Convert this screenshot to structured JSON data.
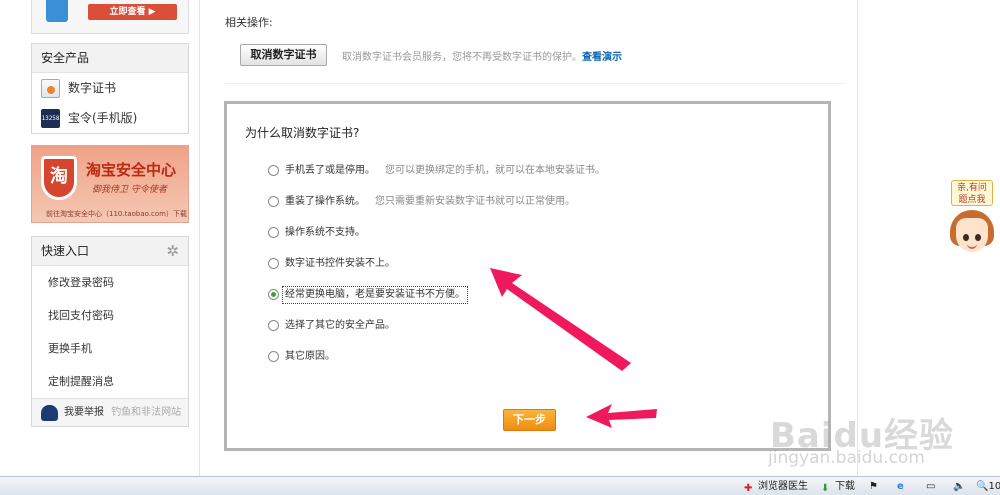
{
  "top_banner": {
    "button_label": "立即查看 ▶"
  },
  "security_products": {
    "title": "安全产品",
    "items": [
      {
        "label": "数字证书",
        "icon": "certificate-icon"
      },
      {
        "label": "宝令(手机版)",
        "icon": "token-icon",
        "icon_text": "13258"
      }
    ]
  },
  "ad": {
    "shield_char": "淘",
    "title": "淘宝安全中心",
    "slogan": "御我侍卫 守令使者",
    "footer": "前往淘宝安全中心（110.taobao.com）下载"
  },
  "quick_entry": {
    "title": "快速入口",
    "items": [
      "修改登录密码",
      "找回支付密码",
      "更换手机",
      "定制提醒消息"
    ],
    "report_label": "我要举报",
    "report_sub": "钓鱼和非法网站"
  },
  "related": {
    "label": "相关操作:",
    "cancel_button": "取消数字证书",
    "description": "取消数字证书会员服务，您将不再受数字证书的保护。",
    "demo_link": "查看演示"
  },
  "survey": {
    "question": "为什么取消数字证书?",
    "options": [
      {
        "label": "手机丢了或是停用。",
        "hint": "您可以更换绑定的手机，就可以在本地安装证书。",
        "selected": false
      },
      {
        "label": "重装了操作系统。",
        "hint": "您只需要重新安装数字证书就可以正常使用。",
        "selected": false
      },
      {
        "label": "操作系统不支持。",
        "hint": "",
        "selected": false
      },
      {
        "label": "数字证书控件安装不上。",
        "hint": "",
        "selected": false
      },
      {
        "label": "经常更换电脑，老是要安装证书不方便。",
        "hint": "",
        "selected": true
      },
      {
        "label": "选择了其它的安全产品。",
        "hint": "",
        "selected": false
      },
      {
        "label": "其它原因。",
        "hint": "",
        "selected": false
      }
    ],
    "next_button": "下一步"
  },
  "helper": {
    "bubble_line1": "亲,有问",
    "bubble_line2": "题点我"
  },
  "watermark": {
    "logo": "Baidu经验",
    "url": "jingyan.baidu.com"
  },
  "statusbar": {
    "doctor_label": "浏览器医生",
    "download_label": "下载",
    "zoom": "10"
  },
  "colors": {
    "accent_orange": "#ef8f14",
    "link_blue": "#0e67b5",
    "arrow_pink": "#f0195e",
    "selected_green": "#3aa63a"
  }
}
